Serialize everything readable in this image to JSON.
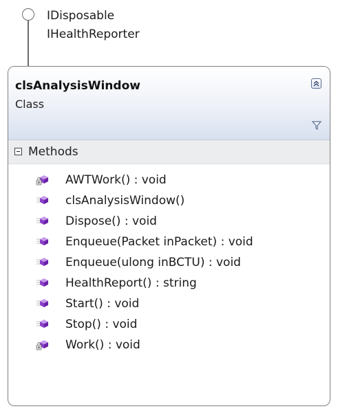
{
  "interfaces": [
    "IDisposable",
    "IHealthReporter"
  ],
  "class": {
    "name": "clsAnalysisWindow",
    "kind": "Class"
  },
  "icons": {
    "collapse": "double-chevron-up-icon",
    "filter": "filter-funnel-icon",
    "section_toggle": "minus-box-icon",
    "public_method": "public-method-icon",
    "private_method": "private-method-icon"
  },
  "colors": {
    "method_cube": "#8a3fc9",
    "header_gradient_end": "#d8e0ef"
  },
  "methods_section": {
    "title": "Methods",
    "items": [
      {
        "label": "AWTWork() : void",
        "access": "private"
      },
      {
        "label": "clsAnalysisWindow()",
        "access": "public"
      },
      {
        "label": "Dispose() : void",
        "access": "public"
      },
      {
        "label": "Enqueue(Packet inPacket) : void",
        "access": "public"
      },
      {
        "label": "Enqueue(ulong inBCTU) : void",
        "access": "public"
      },
      {
        "label": "HealthReport() : string",
        "access": "public"
      },
      {
        "label": "Start() : void",
        "access": "public"
      },
      {
        "label": "Stop() : void",
        "access": "public"
      },
      {
        "label": "Work() : void",
        "access": "private"
      }
    ]
  }
}
